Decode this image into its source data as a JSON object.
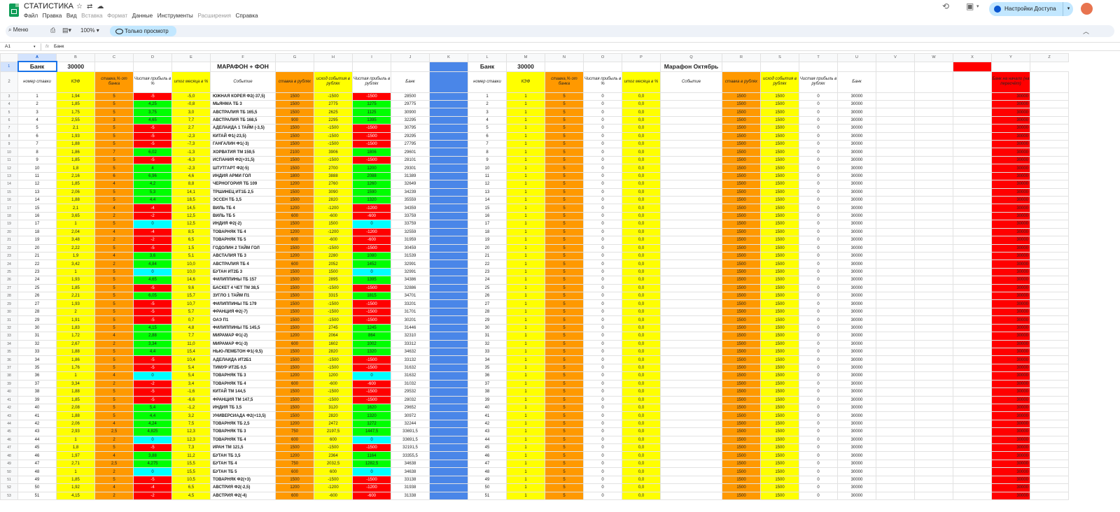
{
  "app": {
    "title": "СТАТИСТИКА",
    "menu": [
      "Файл",
      "Правка",
      "Вид",
      "Вставка",
      "Формат",
      "Данные",
      "Инструменты",
      "Расширения",
      "Справка"
    ],
    "menu_disabled": [
      false,
      false,
      false,
      true,
      true,
      false,
      false,
      true,
      false
    ],
    "share_label": "Настройки Доступа",
    "colors": {
      "green": "#0f9d58",
      "share": "#c2e7ff"
    }
  },
  "toolbar": {
    "menu_label": "Меню",
    "zoom": "100%",
    "view_only": "Только просмотр"
  },
  "formula_bar": {
    "cell_ref": "A1",
    "fx": "fx",
    "value": "Банк"
  },
  "columns": [
    "A",
    "B",
    "C",
    "D",
    "E",
    "F",
    "G",
    "H",
    "I",
    "J",
    "K",
    "L",
    "M",
    "N",
    "O",
    "P",
    "Q",
    "R",
    "S",
    "T",
    "U",
    "V",
    "W",
    "X",
    "Y",
    "Z"
  ],
  "row1": {
    "bank_label": "Банк",
    "bank_value": "30000",
    "marathon_title": "МАРАФОН + ФОН",
    "bank_label2": "Банк",
    "bank_value2": "30000",
    "october_title": "Марафон Октябрь"
  },
  "headers_left": [
    "номер ставки",
    "КЭФ",
    "ставка,% от банка",
    "Чистая прибыль в %",
    "итог месяца в %",
    "Событие",
    "ставка в рублях",
    "исход события в рублях",
    "Чистая прибыль в рублях",
    "Банк"
  ],
  "headers_right": [
    "номер ставки",
    "КЭФ",
    "ставка,% от банка",
    "Чистая прибыль в %",
    "итог месяца в %",
    "Событие",
    "ставка в рублях",
    "исход события в рублях",
    "Чистая прибыль в рублях",
    "Банк"
  ],
  "header_y": "Банк на начало (на пересчёт)",
  "right_defaults": {
    "kef": "1",
    "pct": "5",
    "profit_pct": "0",
    "month": "0,0",
    "stake": "1500",
    "outcome": "1500",
    "profit": "0",
    "bank": "30000",
    "y": "30000"
  },
  "rows": [
    [
      "1",
      "1,94",
      "5",
      "-5",
      "-5,0",
      "ЮЖНАЯ КОРЕЯ Ф2(-37,5)",
      "1500",
      "-1500",
      "-1500",
      "28500"
    ],
    [
      "2",
      "1,85",
      "5",
      "4,25",
      "-0,8",
      "МЬЯНМА ТБ 3",
      "1500",
      "2775",
      "1275",
      "29775"
    ],
    [
      "3",
      "1,75",
      "5",
      "3,75",
      "3,0",
      "АВСТРАЛИЯ ТБ 165,5",
      "1500",
      "2625",
      "1125",
      "30900"
    ],
    [
      "4",
      "2,55",
      "3",
      "4,65",
      "7,7",
      "АВСТРАЛИЯ ТБ 168,5",
      "900",
      "2295",
      "1395",
      "32295"
    ],
    [
      "5",
      "2,1",
      "5",
      "-5",
      "2,7",
      "АДЕЛАИДА 1 ТАЙМ (-3,5)",
      "1500",
      "-1500",
      "-1500",
      "30795"
    ],
    [
      "6",
      "1,93",
      "5",
      "-5",
      "-2,3",
      "КИТАЙ Ф1(-23,5)",
      "1500",
      "-1500",
      "-1500",
      "29295"
    ],
    [
      "7",
      "1,88",
      "5",
      "-5",
      "-7,3",
      "ГАНГАЛИН Ф1(-3)",
      "1500",
      "-1500",
      "-1500",
      "27795"
    ],
    [
      "8",
      "1,86",
      "7",
      "6,02",
      "-1,3",
      "ХОРВАТИЯ ТМ 159,5",
      "2100",
      "3906",
      "1806",
      "29601"
    ],
    [
      "9",
      "1,85",
      "5",
      "-5",
      "-6,3",
      "ИСПАНИЯ Ф2(+31,5)",
      "1500",
      "-1500",
      "-1500",
      "28101"
    ],
    [
      "10",
      "1,8",
      "5",
      "4",
      "-2,3",
      "ШТУТГАРТ Ф2(-5)",
      "1500",
      "2700",
      "1200",
      "29301"
    ],
    [
      "11",
      "2,16",
      "6",
      "6,96",
      "4,6",
      "ИНДИЯ АРМИ ГОЛ",
      "1800",
      "3888",
      "2088",
      "31389"
    ],
    [
      "12",
      "1,85",
      "4",
      "4,2",
      "8,8",
      "ЧЕРНОГОРИЯ ТБ 109",
      "1200",
      "2760",
      "1260",
      "32649"
    ],
    [
      "13",
      "2,06",
      "5",
      "5,3",
      "14,1",
      "ТРШИНЕЦ ИТ1Б 2,5",
      "1500",
      "3090",
      "1590",
      "34239"
    ],
    [
      "14",
      "1,88",
      "5",
      "4,4",
      "18,5",
      "ЭССЕН ТБ 3,5",
      "1500",
      "2820",
      "1320",
      "35559"
    ],
    [
      "15",
      "2,1",
      "4",
      "-4",
      "14,5",
      "ВИЛЬ ТБ 4",
      "1200",
      "-1200",
      "-1200",
      "34359"
    ],
    [
      "16",
      "3,65",
      "2",
      "-2",
      "12,5",
      "ВИЛЬ ТБ 5",
      "600",
      "-600",
      "-600",
      "33759"
    ],
    [
      "17",
      "1",
      "5",
      "0",
      "12,5",
      "ИНДИЯ Ф2(-2)",
      "1500",
      "1500",
      "0",
      "33759"
    ],
    [
      "18",
      "2,04",
      "4",
      "-4",
      "8,5",
      "ТОВАРНЯК ТБ 4",
      "1200",
      "-1200",
      "-1200",
      "32559"
    ],
    [
      "19",
      "3,48",
      "2",
      "-2",
      "6,5",
      "ТОВАРНЯК ТБ 5",
      "600",
      "-600",
      "-600",
      "31959"
    ],
    [
      "20",
      "2,22",
      "5",
      "-5",
      "1,5",
      "ГОДОЛИН 2 ТАЙМ ГОЛ",
      "1500",
      "-1500",
      "-1500",
      "30459"
    ],
    [
      "21",
      "1,9",
      "4",
      "3,6",
      "5,1",
      "АВСТАЛИЯ ТБ 3",
      "1200",
      "2280",
      "1080",
      "31539"
    ],
    [
      "22",
      "3,42",
      "2",
      "4,84",
      "10,0",
      "АВСТРАЛИЯ ТБ 4",
      "600",
      "2052",
      "1452",
      "32991"
    ],
    [
      "23",
      "1",
      "5",
      "0",
      "10,0",
      "БУТАН ИТ2Б 3",
      "1500",
      "1500",
      "0",
      "32991"
    ],
    [
      "24",
      "1,93",
      "5",
      "4,65",
      "14,6",
      "ФИЛИППИНЫ ТБ 157",
      "1500",
      "2895",
      "1395",
      "34386"
    ],
    [
      "25",
      "1,85",
      "5",
      "-5",
      "9,6",
      "БАСКЕТ 4 ЧЕТ ТМ 38,5",
      "1500",
      "-1500",
      "-1500",
      "32886"
    ],
    [
      "26",
      "2,21",
      "5",
      "6,05",
      "15,7",
      "ЗУГЛО 1 ТАЙМ П1",
      "1500",
      "3315",
      "1815",
      "34701"
    ],
    [
      "27",
      "1,93",
      "5",
      "-5",
      "10,7",
      "ФИЛИППИНЫ ТБ 179",
      "1500",
      "-1500",
      "-1500",
      "33201"
    ],
    [
      "28",
      "2",
      "5",
      "-5",
      "5,7",
      "ФРАНЦИЯ Ф2(-7)",
      "1500",
      "-1500",
      "-1500",
      "31701"
    ],
    [
      "29",
      "1,91",
      "5",
      "-5",
      "0,7",
      "ОАЭ П1",
      "1500",
      "-1500",
      "-1500",
      "30201"
    ],
    [
      "30",
      "1,83",
      "5",
      "4,15",
      "4,8",
      "ФИЛИППИНЫ ТБ 145,5",
      "1500",
      "2745",
      "1245",
      "31446"
    ],
    [
      "31",
      "1,72",
      "4",
      "2,88",
      "7,7",
      "МИРАМАР Ф1(-2)",
      "1200",
      "2064",
      "864",
      "32310"
    ],
    [
      "32",
      "2,67",
      "2",
      "3,34",
      "11,0",
      "МИРАМАР Ф1(-3)",
      "600",
      "1602",
      "1002",
      "33312"
    ],
    [
      "33",
      "1,88",
      "5",
      "4,4",
      "15,4",
      "НЬЮ-ЛЕМБТОН Ф1(-9,5)",
      "1500",
      "2820",
      "1320",
      "34632"
    ],
    [
      "34",
      "1,86",
      "5",
      "-5",
      "10,4",
      "АДЕЛАИДА ИТ2Б1",
      "1500",
      "-1500",
      "-1500",
      "33132"
    ],
    [
      "35",
      "1,76",
      "5",
      "-5",
      "5,4",
      "ТИМУР ИТ2Б 0,5",
      "1500",
      "-1500",
      "-1500",
      "31632"
    ],
    [
      "36",
      "1",
      "4",
      "0",
      "5,4",
      "ТОВАРНЯК ТБ 3",
      "1200",
      "1200",
      "0",
      "31632"
    ],
    [
      "37",
      "3,34",
      "2",
      "-2",
      "3,4",
      "ТОВАРНЯК ТБ 4",
      "600",
      "-600",
      "-600",
      "31032"
    ],
    [
      "38",
      "1,88",
      "5",
      "-5",
      "-1,6",
      "КИТАЙ ТМ 144,5",
      "1500",
      "-1500",
      "-1500",
      "29532"
    ],
    [
      "39",
      "1,85",
      "5",
      "-5",
      "-6,6",
      "ФРАНЦИЯ ТМ 147,5",
      "1500",
      "-1500",
      "-1500",
      "28032"
    ],
    [
      "40",
      "2,08",
      "5",
      "5,4",
      "-1,2",
      "ИНДИЯ ТБ 3,5",
      "1500",
      "3120",
      "1620",
      "29652"
    ],
    [
      "41",
      "1,88",
      "5",
      "4,4",
      "3,2",
      "УНИВЕРСИАДА Ф2(+13,5)",
      "1500",
      "2820",
      "1320",
      "30972"
    ],
    [
      "42",
      "2,06",
      "4",
      "4,24",
      "7,5",
      "ТОВАРНЯК ТБ 2,5",
      "1200",
      "2472",
      "1272",
      "32244"
    ],
    [
      "43",
      "2,93",
      "2,5",
      "4,825",
      "12,3",
      "ТОВАРНЯК ТБ 3",
      "750",
      "2197,5",
      "1447,5",
      "33691,5"
    ],
    [
      "44",
      "1",
      "2",
      "0",
      "12,3",
      "ТОВАРНЯК ТБ 4",
      "600",
      "600",
      "0",
      "33691,5"
    ],
    [
      "45",
      "1,8",
      "5",
      "-5",
      "7,3",
      "ИРАН ТМ 121,5",
      "1500",
      "-1500",
      "-1500",
      "32191,5"
    ],
    [
      "46",
      "1,97",
      "4",
      "3,88",
      "11,2",
      "БУТАН ТБ 3,5",
      "1200",
      "2364",
      "1164",
      "33355,5"
    ],
    [
      "47",
      "2,71",
      "2,5",
      "4,275",
      "15,5",
      "БУТАН ТБ 4",
      "750",
      "2032,5",
      "1282,5",
      "34638"
    ],
    [
      "48",
      "1",
      "2",
      "0",
      "15,5",
      "БУТАН ТБ 5",
      "600",
      "600",
      "0",
      "34638"
    ],
    [
      "49",
      "1,85",
      "5",
      "-5",
      "10,5",
      "ТОВАРНЯК Ф2(+3)",
      "1500",
      "-1500",
      "-1500",
      "33138"
    ],
    [
      "50",
      "1,92",
      "4",
      "-4",
      "6,5",
      "АВСТРИЯ Ф2(-2,5)",
      "1200",
      "-1200",
      "-1200",
      "31938"
    ],
    [
      "51",
      "4,15",
      "2",
      "-2",
      "4,5",
      "АВСТРИЯ Ф2(-4)",
      "600",
      "-600",
      "-600",
      "31338"
    ]
  ]
}
